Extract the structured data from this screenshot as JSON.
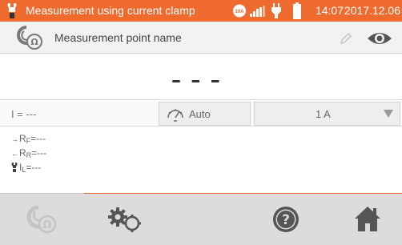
{
  "status_bar": {
    "title": "Measurement using current clamp",
    "clamp_badge": "10A",
    "time": "14:07",
    "date": "2017.12.06",
    "accent_color": "#ee6a2f"
  },
  "header": {
    "label": "Measurement point name",
    "left_icon": "clamp-meter-icon",
    "edit_icon": "pencil-icon",
    "view_icon": "eye-icon"
  },
  "main": {
    "reading": "– – –"
  },
  "controls": {
    "current": "I = ---",
    "mode_label": "Auto",
    "mode_icon": "auto-gauge-icon",
    "range_value": "1 A"
  },
  "results": [
    {
      "arrow": "→",
      "symbol": "R",
      "sub": "F",
      "value": "=---"
    },
    {
      "arrow": "←",
      "symbol": "R",
      "sub": "R",
      "value": "=---"
    },
    {
      "arrow": "",
      "symbol": "I",
      "sub": "L",
      "value": "=---"
    }
  ],
  "bottom_bar": {
    "items": [
      "clamp-meter-icon",
      "settings-gears-icon",
      "help-icon",
      "home-icon"
    ]
  }
}
